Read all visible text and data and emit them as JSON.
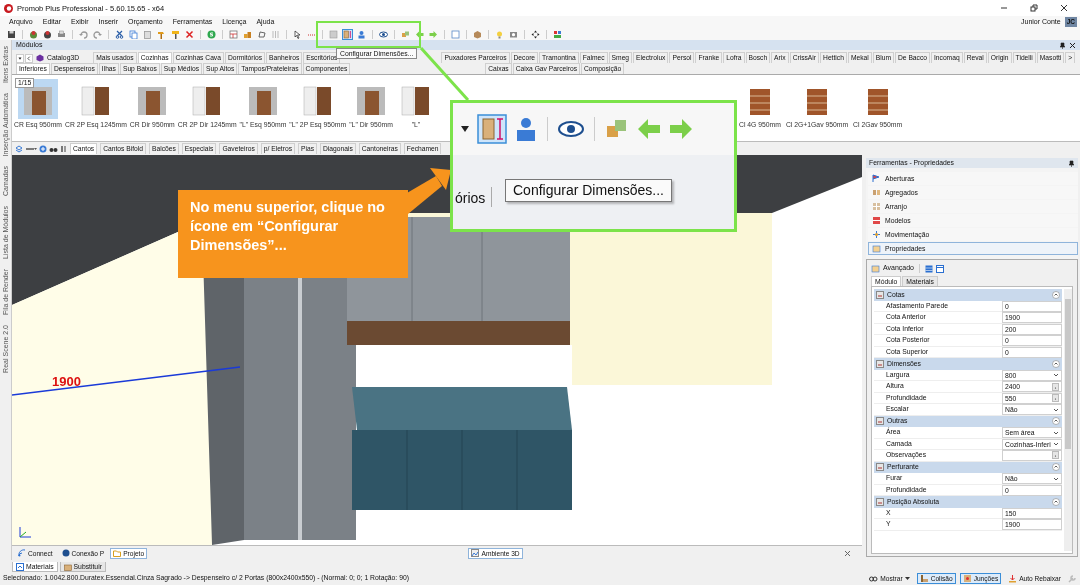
{
  "window": {
    "title": "Promob Plus Professional - 5.60.15.65 - x64"
  },
  "menu": [
    "Arquivo",
    "Editar",
    "Exibir",
    "Inserir",
    "Orçamento",
    "Ferramentas",
    "Licença",
    "Ajuda"
  ],
  "user": {
    "name": "Junior Conte",
    "initials": "JC"
  },
  "tooltip": "Configurar Dimensões...",
  "side_tabs": [
    "Itens Extras",
    "Inserção Automática",
    "Camadas",
    "Lista de Módulos",
    "Fila de Render",
    "Real Scene 2.0"
  ],
  "modules_panel": {
    "title": "Módulos",
    "catalog": "Catalog3D",
    "brand_tabs": [
      {
        "label": "Mais usados",
        "selected": false
      },
      {
        "label": "Cozinhas",
        "selected": true
      },
      {
        "label": "Cozinhas Cava",
        "selected": false
      },
      {
        "label": "Dormitórios",
        "selected": false
      },
      {
        "label": "Banheiros",
        "selected": false
      },
      {
        "label": "Escritórios",
        "selected": false
      }
    ],
    "brand_tabs_continued": [
      {
        "label": "Puxadores Parceiros",
        "selected": false
      },
      {
        "label": "Decore",
        "selected": false
      },
      {
        "label": "Tramontina",
        "selected": false
      },
      {
        "label": "Falmec",
        "selected": false
      },
      {
        "label": "Smeg",
        "selected": false
      },
      {
        "label": "Electrolux",
        "selected": false
      },
      {
        "label": "Persol",
        "selected": false
      },
      {
        "label": "Franke",
        "selected": false
      },
      {
        "label": "Lofra",
        "selected": false
      },
      {
        "label": "Bosch",
        "selected": false
      },
      {
        "label": "Arix",
        "selected": false
      },
      {
        "label": "CrissAir",
        "selected": false
      },
      {
        "label": "Hettich",
        "selected": false
      },
      {
        "label": "Mekal",
        "selected": false
      },
      {
        "label": "Blum",
        "selected": false
      },
      {
        "label": "De Bacco",
        "selected": false
      },
      {
        "label": "Incomaq",
        "selected": false
      },
      {
        "label": "Reval",
        "selected": false
      },
      {
        "label": "Origin",
        "selected": false
      },
      {
        "label": "Tidelli",
        "selected": false
      },
      {
        "label": "Masotti",
        "selected": false
      }
    ],
    "more": ">",
    "section_tabs": [
      {
        "label": "Inferiores",
        "selected": true
      },
      {
        "label": "Despenseiros",
        "selected": false
      },
      {
        "label": "Ilhas",
        "selected": false
      },
      {
        "label": "Sup Baixos",
        "selected": false
      },
      {
        "label": "Sup Médios",
        "selected": false
      },
      {
        "label": "Sup Altos",
        "selected": false
      },
      {
        "label": "Tampos/Prateleiras",
        "selected": false
      },
      {
        "label": "Componentes",
        "selected": false
      }
    ],
    "section_tabs_continued": [
      {
        "label": "Caixas",
        "selected": false
      },
      {
        "label": "Caixa Gav Parceiros",
        "selected": false
      },
      {
        "label": "Composição",
        "selected": false
      }
    ],
    "page": "1/15",
    "items": [
      {
        "label": "CR Esq 950mm",
        "selected": true
      },
      {
        "label": "CR 2P Esq 1245mm",
        "selected": false
      },
      {
        "label": "CR Dir 950mm",
        "selected": false
      },
      {
        "label": "CR 2P Dir 1245mm",
        "selected": false
      },
      {
        "label": "\"L\" Esq 950mm",
        "selected": false
      },
      {
        "label": "\"L\" 2P Esq 950mm",
        "selected": false
      },
      {
        "label": "\"L\" Dir 950mm",
        "selected": false
      },
      {
        "label": "\"L\"",
        "selected": false
      }
    ],
    "items_continued": [
      {
        "label": "Cl 4G 950mm",
        "selected": false
      },
      {
        "label": "Cl 2G+1Gav 950mm",
        "selected": false
      },
      {
        "label": "Cl 2Gav 950mm",
        "selected": false
      }
    ],
    "category_tabs": [
      {
        "label": "Cantos",
        "selected": true
      },
      {
        "label": "Cantos Bifold",
        "selected": false
      },
      {
        "label": "Balcões",
        "selected": false
      },
      {
        "label": "Especiais",
        "selected": false
      },
      {
        "label": "Gaveteiros",
        "selected": false
      },
      {
        "label": "p/ Eletros",
        "selected": false
      },
      {
        "label": "Pias",
        "selected": false
      },
      {
        "label": "Diagonais",
        "selected": false
      },
      {
        "label": "Cantoneiras",
        "selected": false
      },
      {
        "label": "Fechamen",
        "selected": false
      }
    ]
  },
  "viewport": {
    "dimension_label": "1900"
  },
  "callout": {
    "text": "No menu superior, clique no ícone em “Configurar Dimensões”...",
    "zoom_tooltip": "Configurar Dimensões...",
    "zoom_tab": "órios"
  },
  "document_tabs": [
    {
      "label": "Connect",
      "selected": false
    },
    {
      "label": "Conexão P",
      "selected": false
    },
    {
      "label": "Projeto",
      "selected": true
    }
  ],
  "viewport_tab": {
    "label": "Ambiente 3D",
    "selected": true
  },
  "bottom_tabs": [
    {
      "label": "Materiais",
      "selected": true
    },
    {
      "label": "Substituir",
      "selected": false
    }
  ],
  "status": {
    "text": "Selecionado: 1.0042.800.Duratex.Essencial.Cinza Sagrado -> Despenseiro c/ 2 Portas (800x2400x550) - (Normal: 0; 0; 1 Rotação: 90)",
    "controls": [
      {
        "label": "Mostrar",
        "kind": "dropdown",
        "on": false
      },
      {
        "label": "Colisão",
        "kind": "toggle",
        "on": true
      },
      {
        "label": "Junções",
        "kind": "toggle",
        "on": true
      },
      {
        "label": "Auto Rebaixar",
        "kind": "toggle",
        "on": false
      }
    ]
  },
  "properties_panel": {
    "title": "Ferramentas - Propriedades",
    "tools": [
      {
        "label": "Aberturas",
        "selected": false
      },
      {
        "label": "Agregados",
        "selected": false
      },
      {
        "label": "Arranjo",
        "selected": false
      },
      {
        "label": "Modelos",
        "selected": false
      },
      {
        "label": "Movimentação",
        "selected": false
      },
      {
        "label": "Propriedades",
        "selected": true
      }
    ],
    "advanced": "Avançado",
    "tabs": [
      {
        "label": "Módulo",
        "selected": true
      },
      {
        "label": "Materiais",
        "selected": false
      }
    ],
    "sections": [
      {
        "title": "Cotas",
        "expanded": true,
        "rows": [
          {
            "label": "Afastamento Parede",
            "value": "0",
            "kind": "text"
          },
          {
            "label": "Cota Anterior",
            "value": "1900",
            "kind": "text"
          },
          {
            "label": "Cota Inferior",
            "value": "200",
            "kind": "text"
          },
          {
            "label": "Cota Posterior",
            "value": "0",
            "kind": "text"
          },
          {
            "label": "Cota Superior",
            "value": "0",
            "kind": "text"
          }
        ]
      },
      {
        "title": "Dimensões",
        "expanded": true,
        "rows": [
          {
            "label": "Largura",
            "value": "800",
            "kind": "dropdown"
          },
          {
            "label": "Altura",
            "value": "2400",
            "kind": "button"
          },
          {
            "label": "Profundidade",
            "value": "550",
            "kind": "button"
          },
          {
            "label": "Escalar",
            "value": "Não",
            "kind": "dropdown"
          }
        ]
      },
      {
        "title": "Outras",
        "expanded": true,
        "rows": [
          {
            "label": "Área",
            "value": "Sem área",
            "kind": "dropdown"
          },
          {
            "label": "Camada",
            "value": "Cozinhas-Inferi",
            "kind": "dropdown"
          },
          {
            "label": "Observações",
            "value": "",
            "kind": "button"
          }
        ]
      },
      {
        "title": "Perfurante",
        "expanded": true,
        "rows": [
          {
            "label": "Furar",
            "value": "Não",
            "kind": "dropdown"
          },
          {
            "label": "Profundidade",
            "value": "0",
            "kind": "text"
          }
        ]
      },
      {
        "title": "Posição Absoluta",
        "expanded": true,
        "rows": [
          {
            "label": "X",
            "value": "150",
            "kind": "text"
          },
          {
            "label": "Y",
            "value": "1900",
            "kind": "text"
          }
        ]
      }
    ]
  }
}
